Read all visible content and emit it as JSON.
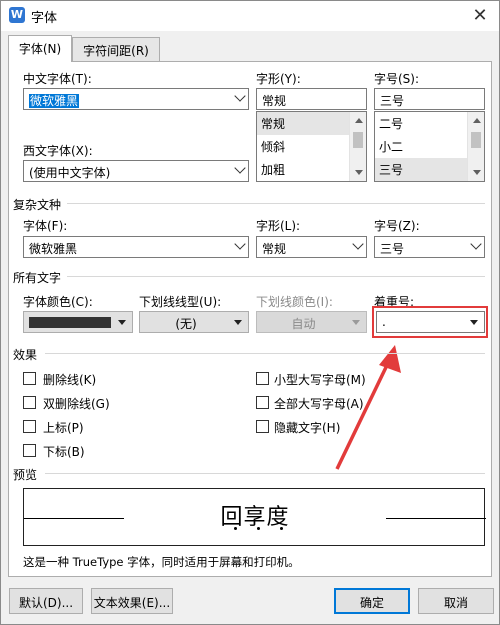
{
  "window": {
    "title": "字体",
    "app_icon": "W"
  },
  "tabs": [
    {
      "label": "字体(N)",
      "active": true
    },
    {
      "label": "字符间距(R)",
      "active": false
    }
  ],
  "chinese_font": {
    "label": "中文字体(T):",
    "value": "微软雅黑"
  },
  "western_font": {
    "label": "西文字体(X):",
    "value": "(使用中文字体)"
  },
  "style": {
    "label": "字形(Y):",
    "value": "常规",
    "options": [
      "常规",
      "倾斜",
      "加粗"
    ],
    "selected_index": 0
  },
  "size": {
    "label": "字号(S):",
    "value": "三号",
    "options": [
      "二号",
      "小二",
      "三号"
    ],
    "selected_index": 2
  },
  "complex": {
    "section_title": "复杂文种",
    "font_label": "字体(F):",
    "font_value": "微软雅黑",
    "style_label": "字形(L):",
    "style_value": "常规",
    "size_label": "字号(Z):",
    "size_value": "三号"
  },
  "all_text": {
    "section_title": "所有文字",
    "font_color_label": "字体颜色(C):",
    "font_color": "#333333",
    "underline_type_label": "下划线线型(U):",
    "underline_type_value": "(无)",
    "underline_color_label": "下划线颜色(I):",
    "underline_color_value": "自动",
    "emphasis_label": "着重号:",
    "emphasis_value": "."
  },
  "effects": {
    "section_title": "效果",
    "left": [
      {
        "label": "删除线(K)",
        "checked": false
      },
      {
        "label": "双删除线(G)",
        "checked": false
      },
      {
        "label": "上标(P)",
        "checked": false
      },
      {
        "label": "下标(B)",
        "checked": false
      }
    ],
    "right": [
      {
        "label": "小型大写字母(M)",
        "checked": false
      },
      {
        "label": "全部大写字母(A)",
        "checked": false
      },
      {
        "label": "隐藏文字(H)",
        "checked": false
      }
    ]
  },
  "preview": {
    "section_title": "预览",
    "text": "回享度"
  },
  "footer_note": "这是一种 TrueType 字体，同时适用于屏幕和打印机。",
  "buttons": {
    "default_label": "默认(D)...",
    "text_effects_label": "文本效果(E)...",
    "ok_label": "确定",
    "cancel_label": "取消"
  },
  "colors": {
    "highlight": "#e23b3b",
    "accent": "#0078d7"
  }
}
